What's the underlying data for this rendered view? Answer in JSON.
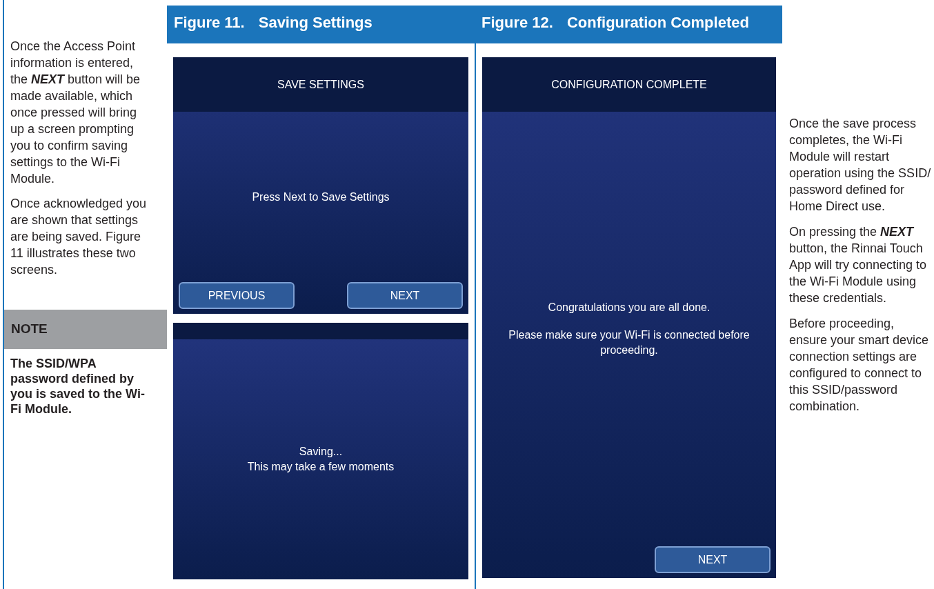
{
  "left_text": {
    "paragraphs": [
      "Once the Access Point information is entered, the **NEXT** button will be made available, which once pressed will bring up a screen prompting you to confirm saving settings to the Wi-Fi Module.",
      "Once acknowledged you are shown that settings are being saved. Figure 11 illustrates these two screens."
    ],
    "note": {
      "heading": "NOTE",
      "text": "The SSID/WPA password defined by you is saved to the Wi-Fi Module."
    }
  },
  "figures": [
    {
      "number": "Figure 11.",
      "title": "Saving Settings",
      "screens": [
        {
          "header": "SAVE SETTINGS",
          "messages": [
            "Press Next to Save Settings"
          ],
          "buttons": [
            "PREVIOUS",
            "NEXT"
          ]
        },
        {
          "messages": [
            "Saving...",
            "This may take a few moments"
          ]
        }
      ]
    },
    {
      "number": "Figure 12.",
      "title": "Configuration Completed",
      "screens": [
        {
          "header": "CONFIGURATION COMPLETE",
          "messages": [
            "Congratulations you are all done.",
            "Please make sure your Wi-Fi is connected before proceeding."
          ],
          "buttons": [
            "NEXT"
          ]
        }
      ]
    }
  ],
  "right_text": {
    "paragraphs": [
      "Once the save process completes, the Wi-Fi Module will restart operation using the SSID/ password defined for Home Direct use.",
      "On pressing the **NEXT** button, the Rinnai Touch App will try connecting to the Wi-Fi Module using these credentials.",
      "Before proceeding, ensure your smart device connection settings are configured to connect to this SSID/password combination."
    ]
  }
}
